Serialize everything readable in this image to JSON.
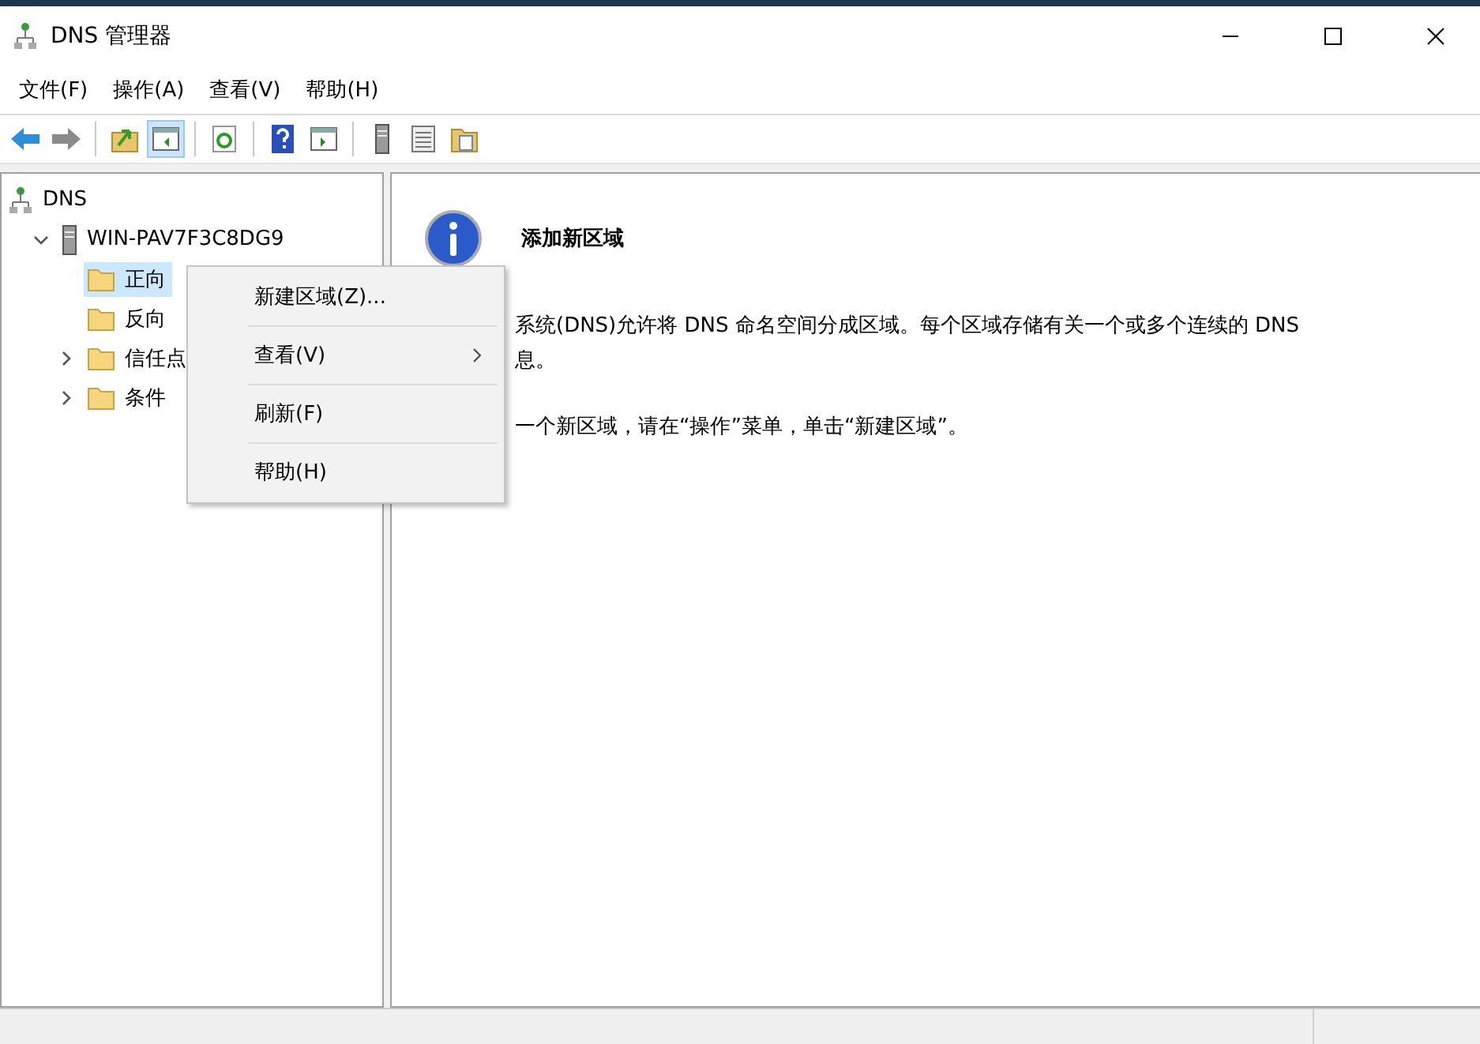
{
  "window": {
    "title": "DNS 管理器"
  },
  "menu_bar": [
    {
      "label": "文件(F)"
    },
    {
      "label": "操作(A)"
    },
    {
      "label": "查看(V)"
    },
    {
      "label": "帮助(H)"
    }
  ],
  "toolbar": [
    {
      "kind": "back",
      "pressed": false
    },
    {
      "kind": "forward",
      "pressed": false
    },
    {
      "kind": "separator"
    },
    {
      "kind": "up",
      "pressed": false
    },
    {
      "kind": "tree",
      "pressed": true
    },
    {
      "kind": "separator"
    },
    {
      "kind": "refresh",
      "pressed": false
    },
    {
      "kind": "separator"
    },
    {
      "kind": "help",
      "pressed": false
    },
    {
      "kind": "pane",
      "pressed": false
    },
    {
      "kind": "separator"
    },
    {
      "kind": "server",
      "pressed": false
    },
    {
      "kind": "list",
      "pressed": false
    },
    {
      "kind": "export",
      "pressed": false
    }
  ],
  "tree": [
    {
      "label": "DNS",
      "kind": "root",
      "selected": false,
      "children": [
        {
          "label": "WIN-PAV7F3C8DG9",
          "kind": "server",
          "expandable": true,
          "expanded": true,
          "selected": false,
          "children": [
            {
              "label": "正向",
              "kind": "folder",
              "expandable": false,
              "expanded": false,
              "selected": true
            },
            {
              "label": "反向",
              "kind": "folder",
              "expandable": false,
              "expanded": false,
              "selected": false
            },
            {
              "label": "信任点",
              "kind": "folder",
              "expandable": true,
              "expanded": false,
              "selected": false
            },
            {
              "label": "条件",
              "kind": "folder",
              "expandable": true,
              "expanded": false,
              "selected": false
            }
          ]
        }
      ]
    }
  ],
  "details": {
    "title": "添加新区域",
    "paragraphs": [
      [
        "系统(DNS)允许将 DNS 命名空间分成区域。每个区域存储有关一个或多个连续的 DNS",
        "息。"
      ],
      [
        "一个新区域，请在“操作”菜单，单击“新建区域”。"
      ]
    ]
  },
  "context_menu": [
    {
      "label": "新建区域(Z)...",
      "submenu": false
    },
    {
      "label": "查看(V)",
      "submenu": true
    },
    {
      "label": "刷新(F)",
      "submenu": false
    },
    {
      "label": "帮助(H)",
      "submenu": false
    }
  ]
}
